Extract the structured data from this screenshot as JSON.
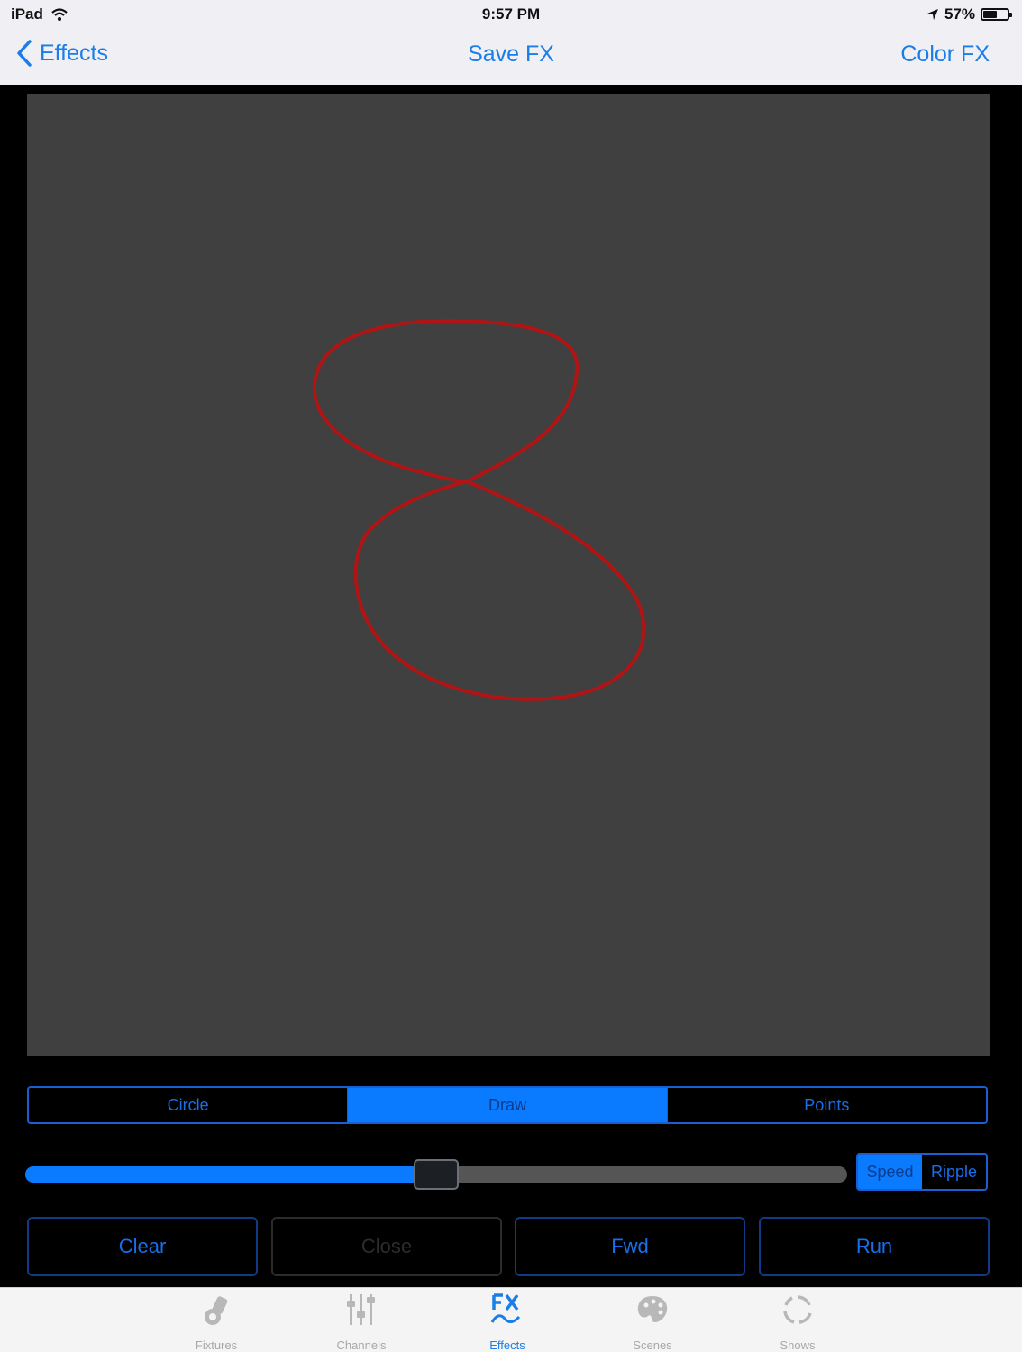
{
  "status_bar": {
    "device": "iPad",
    "time": "9:57 PM",
    "battery_text": "57%",
    "battery_level": 0.57
  },
  "nav_bar": {
    "back_label": "Effects",
    "title": "Save FX",
    "right_label": "Color FX"
  },
  "shape_modes": {
    "items": [
      "Circle",
      "Draw",
      "Points"
    ],
    "selected": "Draw"
  },
  "slider": {
    "value": 0.5
  },
  "mode_toggle": {
    "options": [
      "Speed",
      "Ripple"
    ],
    "selected": "Speed"
  },
  "actions": {
    "clear": "Clear",
    "close": "Close",
    "fwd": "Fwd",
    "run": "Run"
  },
  "tab_bar": {
    "tabs": [
      "Fixtures",
      "Channels",
      "Effects",
      "Scenes",
      "Shows"
    ],
    "active": "Effects"
  },
  "colors": {
    "accent": "#0a7bff",
    "drawing_stroke": "#b01414",
    "canvas": "#404040"
  },
  "icons": {
    "back": "chevron-left-icon",
    "wifi": "wifi-icon",
    "location": "location-arrow-icon",
    "battery": "battery-icon",
    "fixtures": "spotlight-icon",
    "channels": "faders-icon",
    "effects": "fx-icon",
    "scenes": "palette-icon",
    "shows": "cycle-icon"
  }
}
